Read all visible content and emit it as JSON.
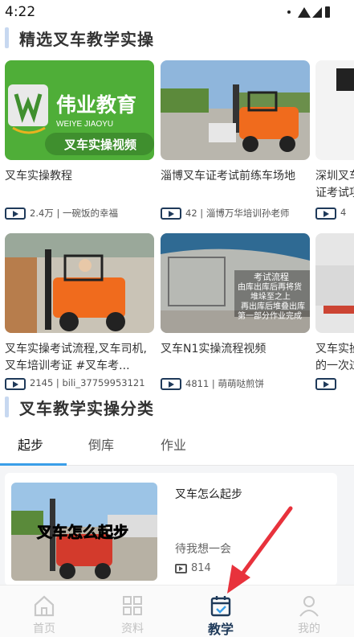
{
  "status_bar": {
    "time": "4:22"
  },
  "featured": {
    "title": "精选叉车教学实操",
    "cards": [
      {
        "title": "叉车实操教程",
        "meta": "2.4万 | 一碗饭的幸福",
        "thumb_caption_big": "伟业教育",
        "thumb_caption_small": "WEIYE JIAOYU",
        "thumb_caption_tag": "叉车实操视频"
      },
      {
        "title": "淄博叉车证考试前练车场地",
        "meta": "42 | 淄博万华培训孙老师"
      },
      {
        "title": "深圳叉车证考试项目一场地",
        "meta": "4"
      },
      {
        "title": "叉车实操考试流程,叉车司机,叉车培训考证 #叉车考...",
        "meta": "2145 | bili_37759953121"
      },
      {
        "title": "叉车N1实操流程视频",
        "meta": "4811 | 萌萌哒煎饼",
        "thumb_caption": "考试流程\n由库出库后再将货\n堆垛至之上\n再出库后堆叠出库\n第一部分作业完成"
      },
      {
        "title": "叉车实操的一次过",
        "meta": ""
      }
    ]
  },
  "category": {
    "title": "叉车教学实操分类",
    "tabs": [
      "起步",
      "倒库",
      "作业"
    ],
    "active_tab": 0
  },
  "list": [
    {
      "title": "叉车怎么起步",
      "author": "待我想一会",
      "views": "814",
      "thumb_caption": "叉车怎么起步"
    }
  ],
  "bottom_nav": {
    "items": [
      {
        "label": "首页",
        "icon": "home-icon"
      },
      {
        "label": "资料",
        "icon": "grid-icon"
      },
      {
        "label": "教学",
        "icon": "calendar-check-icon"
      },
      {
        "label": "我的",
        "icon": "user-icon"
      }
    ],
    "active": 2
  },
  "colors": {
    "accent": "#1f3a5a",
    "tab_underline": "#3a9ee8",
    "annotation_arrow": "#e8323c"
  }
}
